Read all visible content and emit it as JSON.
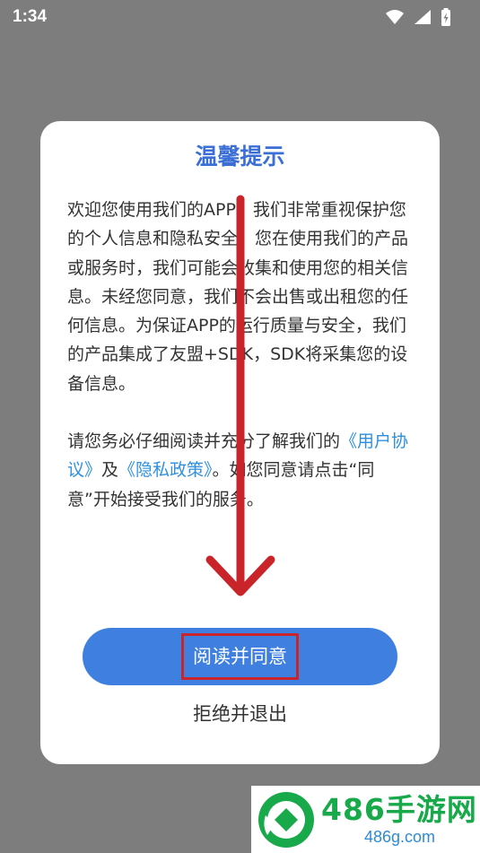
{
  "status_bar": {
    "time": "1:34",
    "icons": [
      "wifi-icon",
      "signal-icon",
      "battery-charging-icon"
    ]
  },
  "dialog": {
    "title": "温馨提示",
    "body": {
      "p1": "欢迎您使用我们的APP！我们非常重视保护您的个人信息和隐私安全。您在使用我们的产品或服务时，我们可能会收集和使用您的相关信息。未经您同意，我们不会出售或出租您的任何信息。为保证APP的运行质量与安全，我们的产品集成了友盟+SDK，SDK将采集您的设备信息。",
      "p2_before": "请您务必仔细阅读并充分了解我们的",
      "user_agreement_link": "《用户协议》",
      "and": "及",
      "privacy_policy_link": "《隐私政策》",
      "p2_after": "。如您同意请点击“同意”开始接受我们的服务。"
    },
    "agree_button_label": "阅读并同意",
    "refuse_button_label": "拒绝并退出"
  },
  "colors": {
    "overlay": "#7d7d7d",
    "title": "#3b6fd6",
    "link": "#2d8fe0",
    "primary_button": "#3f7fe0",
    "annotation": "#c9242a"
  },
  "watermark": {
    "brand": "486手游网",
    "domain": "486g.com"
  }
}
